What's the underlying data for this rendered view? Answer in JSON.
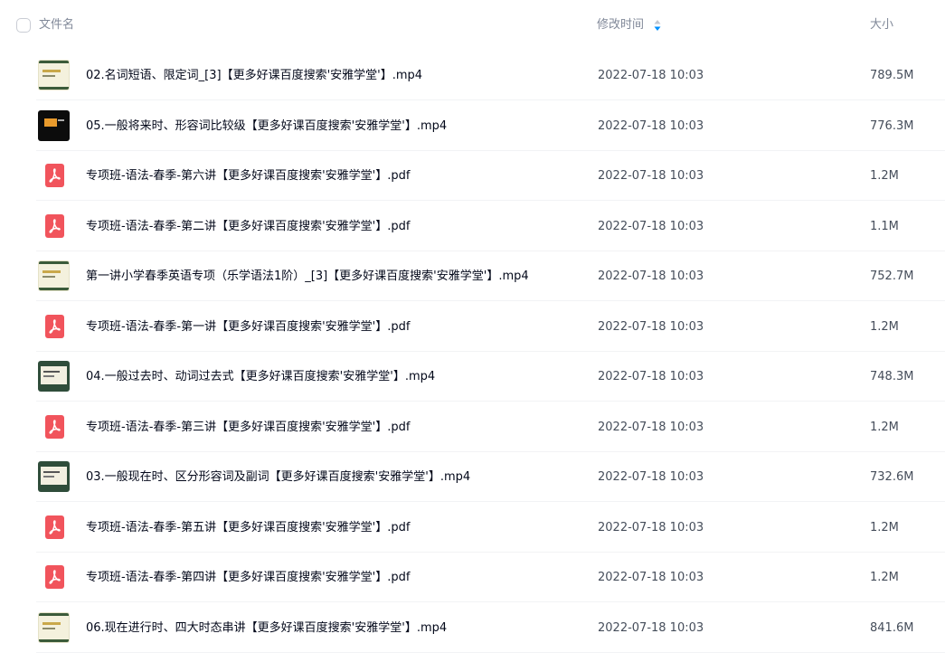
{
  "header": {
    "name_label": "文件名",
    "time_label": "修改时间",
    "size_label": "大小",
    "sort_icon": "sort-desc-icon"
  },
  "colors": {
    "pdf_red": "#f1545c",
    "sort_blue": "#0091ff",
    "header_text": "#818999"
  },
  "files": [
    {
      "name": "02.名词短语、限定词_[3]【更多好课百度搜索'安雅学堂'】.mp4",
      "time": "2022-07-18 10:03",
      "size": "789.5M",
      "type": "video",
      "thumb": "light"
    },
    {
      "name": "05.一般将来时、形容词比较级【更多好课百度搜索'安雅学堂'】.mp4",
      "time": "2022-07-18 10:03",
      "size": "776.3M",
      "type": "video",
      "thumb": "dark"
    },
    {
      "name": "专项班-语法-春季-第六讲【更多好课百度搜索'安雅学堂'】.pdf",
      "time": "2022-07-18 10:03",
      "size": "1.2M",
      "type": "pdf"
    },
    {
      "name": "专项班-语法-春季-第二讲【更多好课百度搜索'安雅学堂'】.pdf",
      "time": "2022-07-18 10:03",
      "size": "1.1M",
      "type": "pdf"
    },
    {
      "name": "第一讲小学春季英语专项（乐学语法1阶）_[3]【更多好课百度搜索'安雅学堂'】.mp4",
      "time": "2022-07-18 10:03",
      "size": "752.7M",
      "type": "video",
      "thumb": "light"
    },
    {
      "name": "专项班-语法-春季-第一讲【更多好课百度搜索'安雅学堂'】.pdf",
      "time": "2022-07-18 10:03",
      "size": "1.2M",
      "type": "pdf"
    },
    {
      "name": "04.一般过去时、动词过去式【更多好课百度搜索'安雅学堂'】.mp4",
      "time": "2022-07-18 10:03",
      "size": "748.3M",
      "type": "video",
      "thumb": "green"
    },
    {
      "name": "专项班-语法-春季-第三讲【更多好课百度搜索'安雅学堂'】.pdf",
      "time": "2022-07-18 10:03",
      "size": "1.2M",
      "type": "pdf"
    },
    {
      "name": "03.一般现在时、区分形容词及副词【更多好课百度搜索'安雅学堂'】.mp4",
      "time": "2022-07-18 10:03",
      "size": "732.6M",
      "type": "video",
      "thumb": "green"
    },
    {
      "name": "专项班-语法-春季-第五讲【更多好课百度搜索'安雅学堂'】.pdf",
      "time": "2022-07-18 10:03",
      "size": "1.2M",
      "type": "pdf"
    },
    {
      "name": "专项班-语法-春季-第四讲【更多好课百度搜索'安雅学堂'】.pdf",
      "time": "2022-07-18 10:03",
      "size": "1.2M",
      "type": "pdf"
    },
    {
      "name": "06.现在进行时、四大时态串讲【更多好课百度搜索'安雅学堂'】.mp4",
      "time": "2022-07-18 10:03",
      "size": "841.6M",
      "type": "video",
      "thumb": "light"
    }
  ]
}
